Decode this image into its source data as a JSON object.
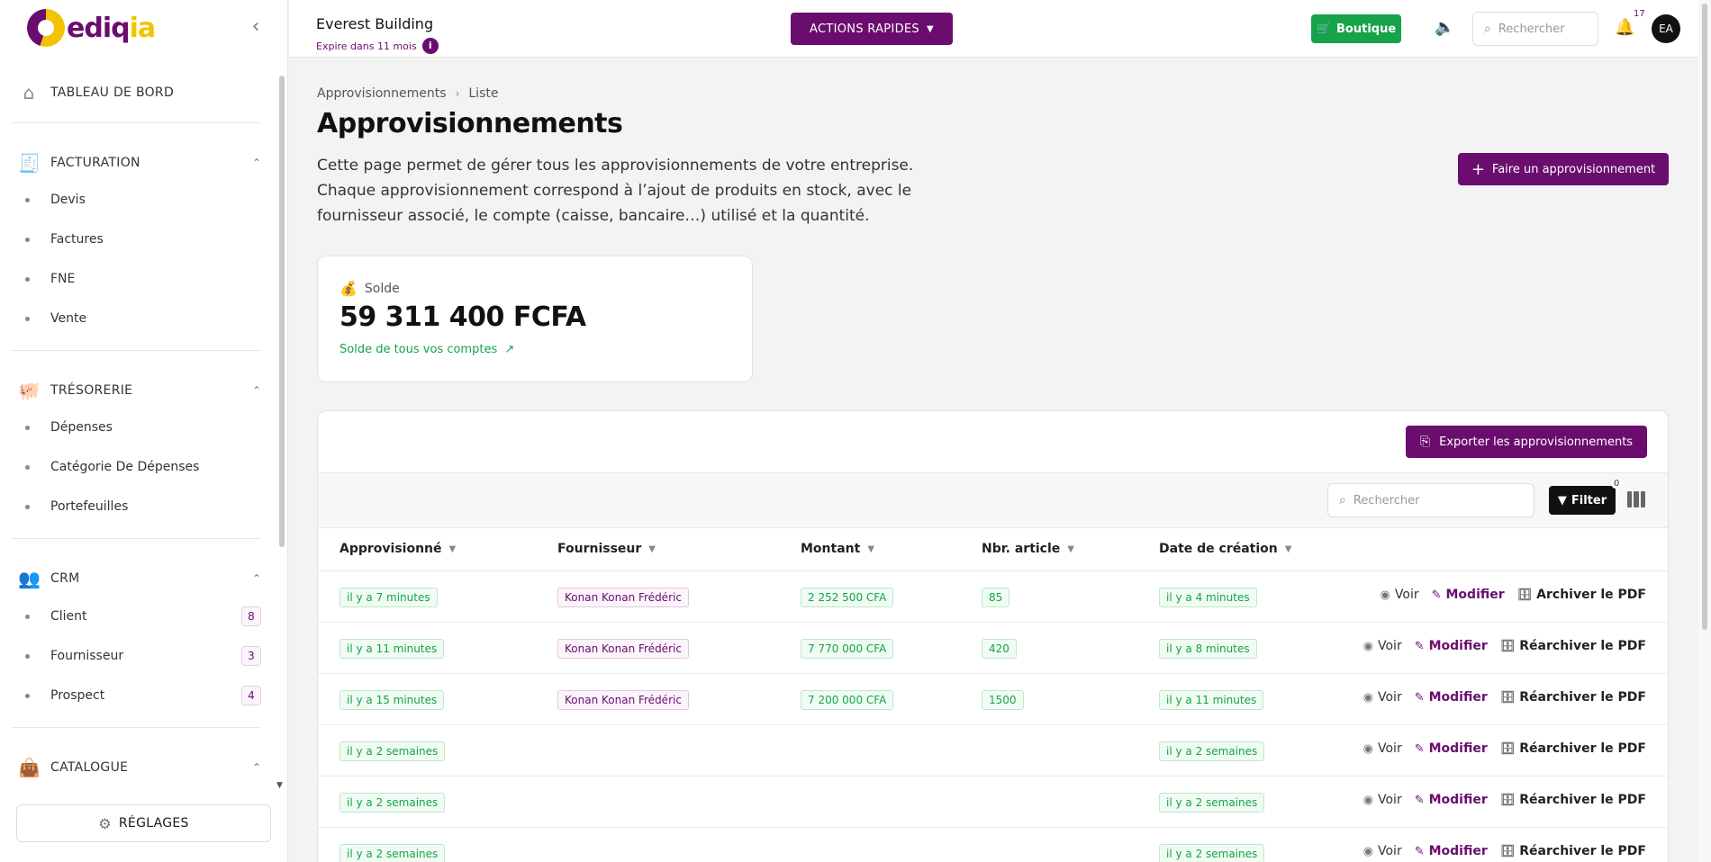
{
  "brand": {
    "name_main": "ediq",
    "name_accent": "ia",
    "primary": "#6a0d6e",
    "accent": "#f2c400",
    "success": "#16a34a"
  },
  "header": {
    "company": "Everest Building",
    "expire": "Expire dans 11 mois",
    "quick_actions": "ACTIONS RAPIDES",
    "shop": "Boutique",
    "search_placeholder": "Rechercher",
    "notif_count": "17",
    "avatar": "EA"
  },
  "sidebar": {
    "dashboard": "TABLEAU DE BORD",
    "billing": {
      "label": "FACTURATION",
      "items": [
        "Devis",
        "Factures",
        "FNE",
        "Vente"
      ]
    },
    "treasury": {
      "label": "TRÉSORERIE",
      "items": [
        "Dépenses",
        "Catégorie De Dépenses",
        "Portefeuilles"
      ]
    },
    "crm": {
      "label": "CRM",
      "items": [
        {
          "label": "Client",
          "count": "8"
        },
        {
          "label": "Fournisseur",
          "count": "3"
        },
        {
          "label": "Prospect",
          "count": "4"
        }
      ]
    },
    "catalogue": {
      "label": "CATALOGUE"
    },
    "settings": "RÉGLAGES"
  },
  "breadcrumb": {
    "root": "Approvisionnements",
    "current": "Liste"
  },
  "page": {
    "title": "Approvisionnements",
    "description": "Cette page permet de gérer tous les approvisionnements de votre entreprise. Chaque approvisionnement correspond à l’ajout de produits en stock, avec le fournisseur associé, le compte (caisse, bancaire…) utilisé et la quantité.",
    "add_button": "Faire un approvisionnement"
  },
  "balance": {
    "label": "Solde",
    "amount": "59 311 400 FCFA",
    "subtitle": "Solde de tous vos comptes"
  },
  "table": {
    "export_button": "Exporter les approvisionnements",
    "search_placeholder": "Rechercher",
    "filter_label": "Filter",
    "filter_count": "0",
    "columns": [
      "Approvisionné",
      "Fournisseur",
      "Montant",
      "Nbr. article",
      "Date de création"
    ],
    "actions": {
      "view": "Voir",
      "edit": "Modifier"
    },
    "rows": [
      {
        "supplied": "il y a 7 minutes",
        "supplier": "Konan Konan Frédéric",
        "amount": "2 252 500 CFA",
        "items": "85",
        "created": "il y a 4 minutes",
        "archive": "Archiver le PDF"
      },
      {
        "supplied": "il y a 11 minutes",
        "supplier": "Konan Konan Frédéric",
        "amount": "7 770 000 CFA",
        "items": "420",
        "created": "il y a 8 minutes",
        "archive": "Réarchiver le PDF"
      },
      {
        "supplied": "il y a 15 minutes",
        "supplier": "Konan Konan Frédéric",
        "amount": "7 200 000 CFA",
        "items": "1500",
        "created": "il y a 11 minutes",
        "archive": "Réarchiver le PDF"
      },
      {
        "supplied": "il y a 2 semaines",
        "supplier": "",
        "amount": "",
        "items": "",
        "created": "il y a 2 semaines",
        "archive": "Réarchiver le PDF"
      },
      {
        "supplied": "il y a 2 semaines",
        "supplier": "",
        "amount": "",
        "items": "",
        "created": "il y a 2 semaines",
        "archive": "Réarchiver le PDF"
      },
      {
        "supplied": "il y a 2 semaines",
        "supplier": "",
        "amount": "",
        "items": "",
        "created": "il y a 2 semaines",
        "archive": "Réarchiver le PDF"
      }
    ]
  }
}
